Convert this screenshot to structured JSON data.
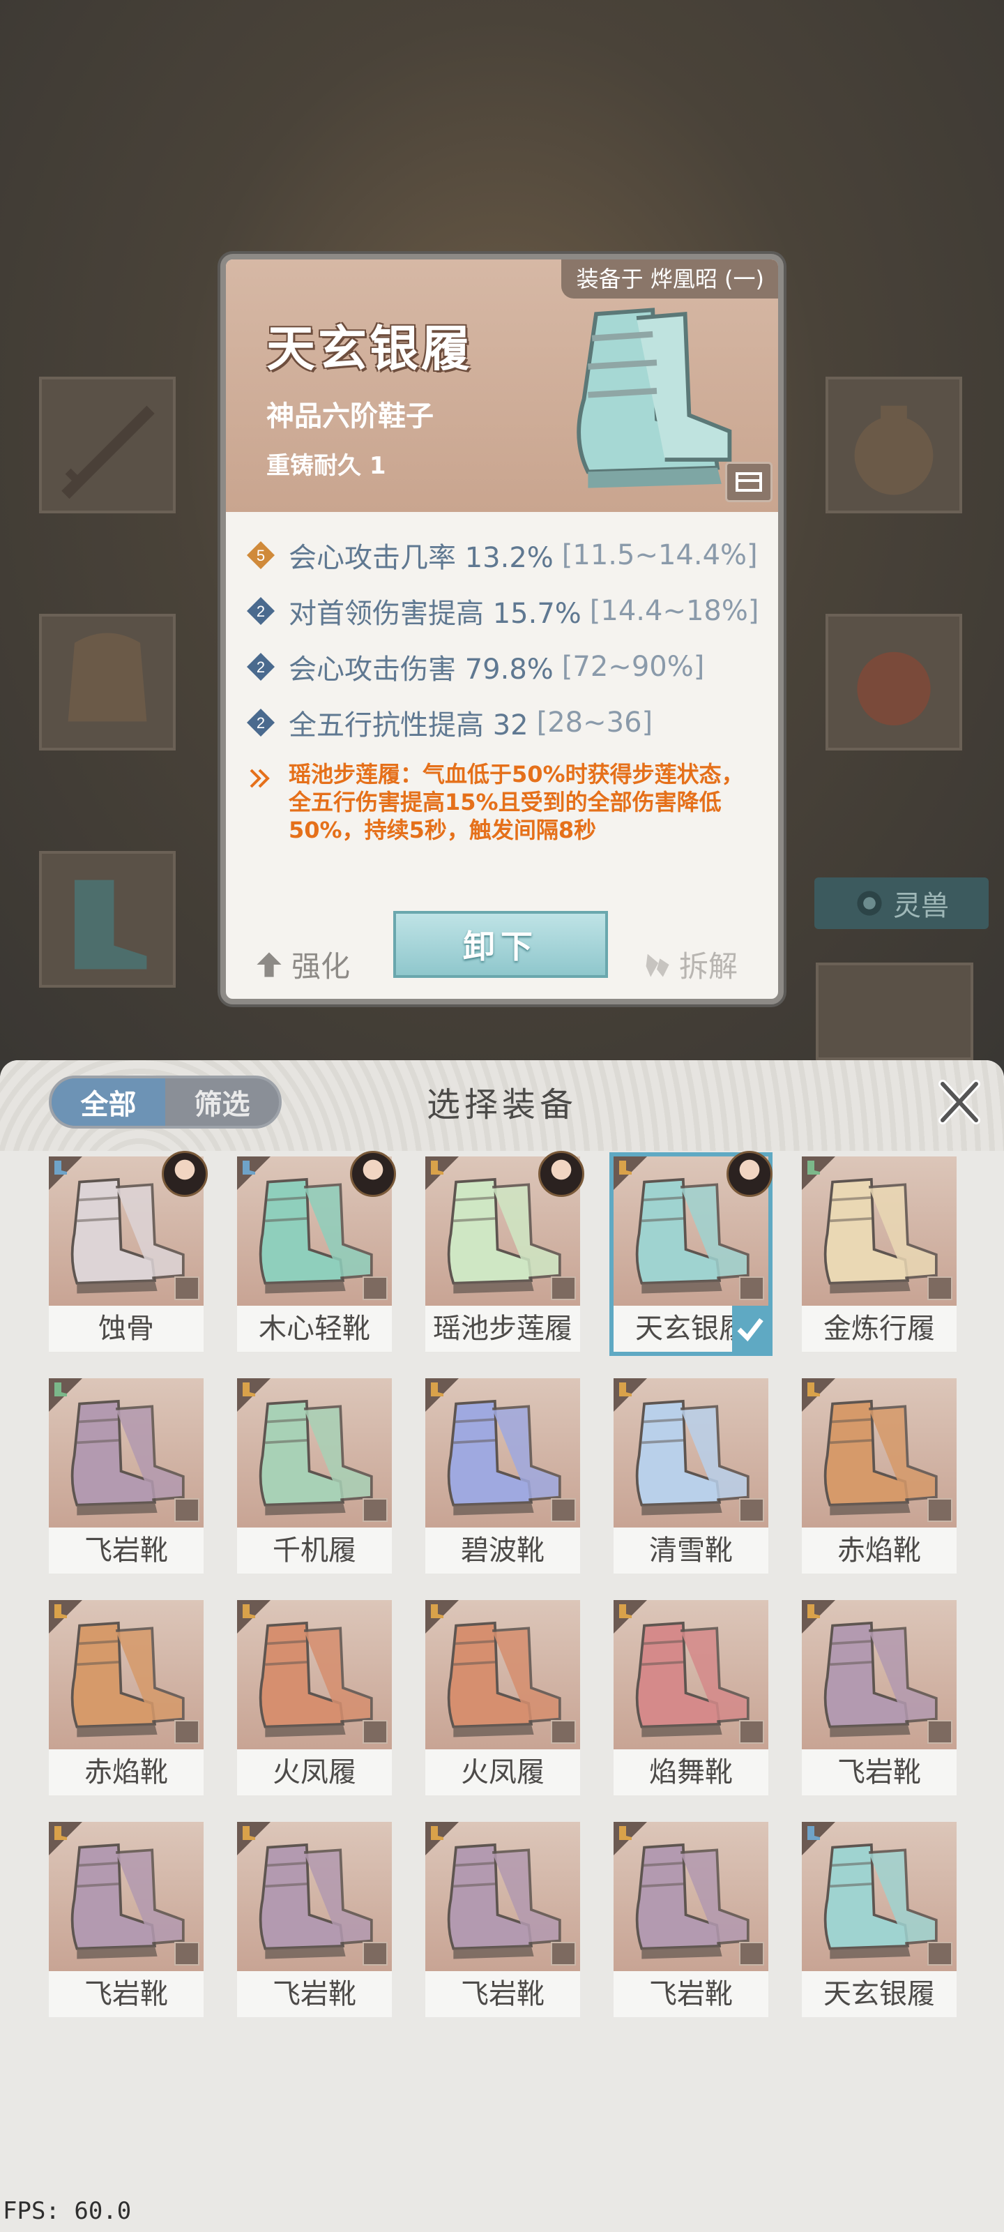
{
  "background_scene": {
    "spirit_beast_label": "灵兽"
  },
  "detail_card": {
    "equipped_by": "装备于 烨凰昭 (一)",
    "item_name": "天玄银履",
    "grade": "神品六阶鞋子",
    "durability": "重铸耐久 1",
    "stats": [
      {
        "badge": "5",
        "badge_color": "#d08a3a",
        "text": "会心攻击几率 13.2%",
        "range": "[11.5~14.4%]"
      },
      {
        "badge": "2",
        "badge_color": "#4a6a8e",
        "text": "对首领伤害提高 15.7%",
        "range": "[14.4~18%]"
      },
      {
        "badge": "2",
        "badge_color": "#4a6a8e",
        "text": "会心攻击伤害 79.8%",
        "range": "[72~90%]"
      },
      {
        "badge": "2",
        "badge_color": "#4a6a8e",
        "text": "全五行抗性提高 32",
        "range": "[28~36]"
      }
    ],
    "set_effect": "瑶池步莲履：气血低于50%时获得步莲状态，全五行伤害提高15%且受到的全部伤害降低50%，持续5秒，触发间隔8秒",
    "buttons": {
      "enhance": "强化",
      "unequip": "卸下",
      "dismantle": "拆解"
    }
  },
  "select_panel": {
    "tabs": [
      "全部",
      "筛选"
    ],
    "title": "选择装备",
    "items": [
      {
        "name": "蚀骨",
        "corner": "#6fa3c8",
        "color": "#ddd4d6",
        "avatar": true
      },
      {
        "name": "木心轻靴",
        "corner": "#6fa3c8",
        "color": "#8fcfbc",
        "avatar": true
      },
      {
        "name": "瑶池步莲履",
        "corner": "#d9a24a",
        "color": "#cfe7c4",
        "avatar": true
      },
      {
        "name": "天玄银履",
        "corner": "#d9a24a",
        "color": "#9fd3d0",
        "avatar": true,
        "selected": true
      },
      {
        "name": "金炼行履",
        "corner": "#7bb88a",
        "color": "#ead8b4"
      },
      {
        "name": "飞岩靴",
        "corner": "#7bb88a",
        "color": "#b39ab0"
      },
      {
        "name": "千机履",
        "corner": "#d9a24a",
        "color": "#a8d1b6"
      },
      {
        "name": "碧波靴",
        "corner": "#d9a24a",
        "color": "#9fa9e0"
      },
      {
        "name": "清雪靴",
        "corner": "#d9a24a",
        "color": "#b9d0ea"
      },
      {
        "name": "赤焰靴",
        "corner": "#d9a24a",
        "color": "#d69a6a"
      },
      {
        "name": "赤焰靴",
        "corner": "#d9a24a",
        "color": "#d69a6a"
      },
      {
        "name": "火凤履",
        "corner": "#d9a24a",
        "color": "#d68f6f"
      },
      {
        "name": "火凤履",
        "corner": "#d9a24a",
        "color": "#d68f6f"
      },
      {
        "name": "焰舞靴",
        "corner": "#d9a24a",
        "color": "#d58a8a"
      },
      {
        "name": "飞岩靴",
        "corner": "#d9a24a",
        "color": "#b39ab0"
      },
      {
        "name": "飞岩靴",
        "corner": "#d9a24a",
        "color": "#b39ab0"
      },
      {
        "name": "飞岩靴",
        "corner": "#d9a24a",
        "color": "#b39ab0"
      },
      {
        "name": "飞岩靴",
        "corner": "#d9a24a",
        "color": "#b39ab0"
      },
      {
        "name": "飞岩靴",
        "corner": "#d9a24a",
        "color": "#b39ab0"
      },
      {
        "name": "天玄银履",
        "corner": "#6fa3c8",
        "color": "#9fd3d0"
      }
    ]
  },
  "fps": "FPS: 60.0"
}
